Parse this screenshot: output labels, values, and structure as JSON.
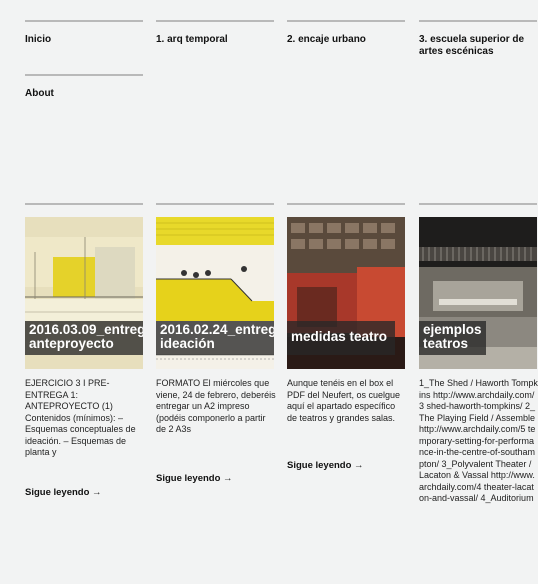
{
  "nav": {
    "inicio": "Inicio",
    "about": "About",
    "item1": "1. arq temporal",
    "item2": "2. encaje urbano",
    "item3": "3. escuela superior de artes escénicas"
  },
  "posts": [
    {
      "caption_line1": "2016.03.09_entreg",
      "caption_line2": "anteproyecto",
      "excerpt": "EJERCICIO 3 I PRE-ENTREGA 1: ANTEPROYECTO (1) Contenidos (mínimos): – Esquemas conceptuales de ideación. – Esquemas de planta y",
      "read_more": "Sigue leyendo →"
    },
    {
      "caption_line1": "2016.02.24_entreg",
      "caption_line2": "ideación",
      "excerpt": "FORMATO El miércoles que viene, 24 de febrero, deberéis entregar un A2 impreso (podéis componerlo a partir de 2 A3s",
      "read_more": "Sigue leyendo →"
    },
    {
      "caption_line1": "medidas teatro",
      "caption_line2": "",
      "excerpt": "Aunque tenéis en el box el PDF del Neufert, os cuelgue aquí el apartado específico de teatros y grandes salas.",
      "read_more": "Sigue leyendo →"
    },
    {
      "caption_line1": "ejemplos",
      "caption_line2": "teatros",
      "excerpt": "1_The Shed / Haworth Tompkins http://www.archdaily.com/3 shed-haworth-tompkins/ 2_The Playing Field / Assemble http://www.archdaily.com/5 temporary-setting-for-performance-in-the-centre-of-southampton/ 3_Polyvalent Theater / Lacaton & Vassal http://www.archdaily.com/4 theater-lacaton-and-vassal/ 4_Auditorium",
      "read_more": ""
    }
  ],
  "colors": {
    "background": "#f2f3f3",
    "rule": "#b9b9b9",
    "caption_bg": "#282828",
    "accent_yellow": "#e4d21a"
  }
}
